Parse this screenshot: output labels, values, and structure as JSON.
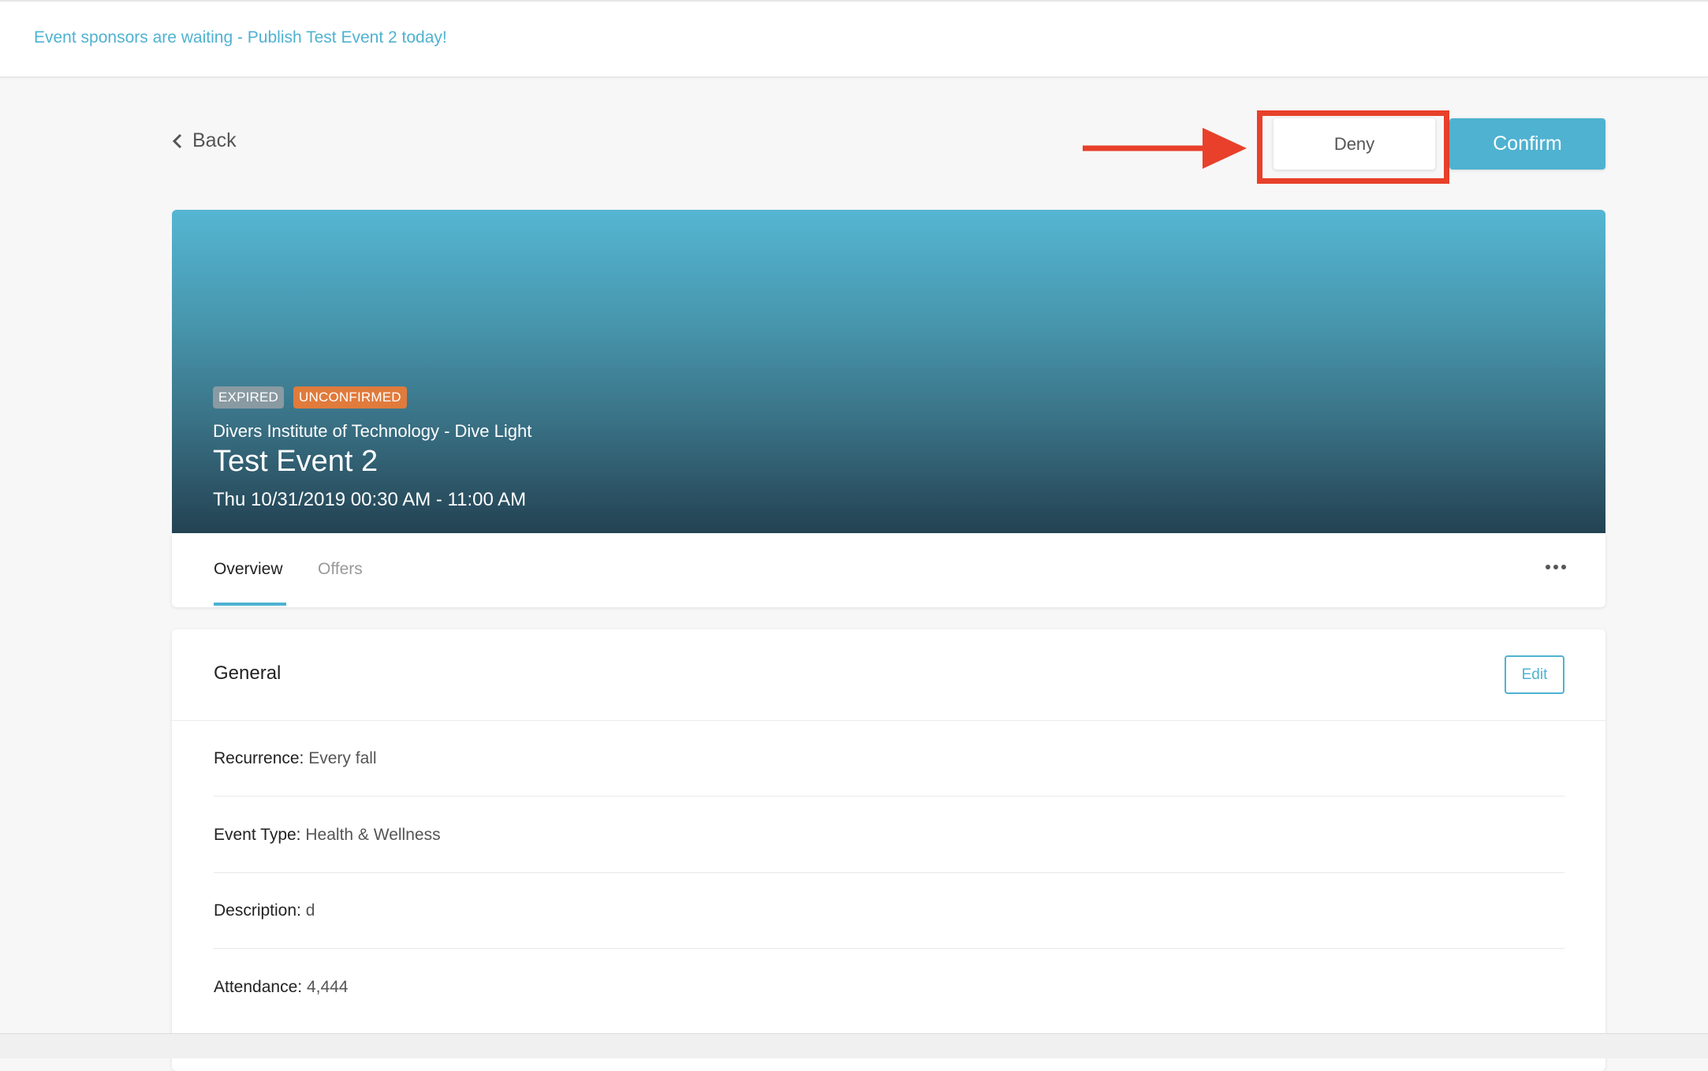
{
  "banner": {
    "promo_text": "Event sponsors are waiting - Publish Test Event 2 today!"
  },
  "nav": {
    "back_label": "Back"
  },
  "actions": {
    "deny_label": "Deny",
    "confirm_label": "Confirm",
    "highlight_color": "#e8402a"
  },
  "event": {
    "badges": [
      "EXPIRED",
      "UNCONFIRMED"
    ],
    "organization": "Divers Institute of Technology - Dive Light",
    "title": "Test Event 2",
    "datetime": "Thu 10/31/2019 00:30 AM - 11:00 AM"
  },
  "tabs": [
    {
      "label": "Overview",
      "active": true
    },
    {
      "label": "Offers",
      "active": false
    }
  ],
  "general": {
    "title": "General",
    "edit_label": "Edit",
    "fields": [
      {
        "label": "Recurrence:",
        "value": "Every fall"
      },
      {
        "label": "Event Type:",
        "value": "Health & Wellness"
      },
      {
        "label": "Description:",
        "value": "d"
      },
      {
        "label": "Attendance:",
        "value": "4,444"
      }
    ]
  },
  "colors": {
    "accent": "#4fb2d1",
    "expired_badge": "#8a9aa2",
    "unconfirmed_badge": "#e07b3c"
  }
}
